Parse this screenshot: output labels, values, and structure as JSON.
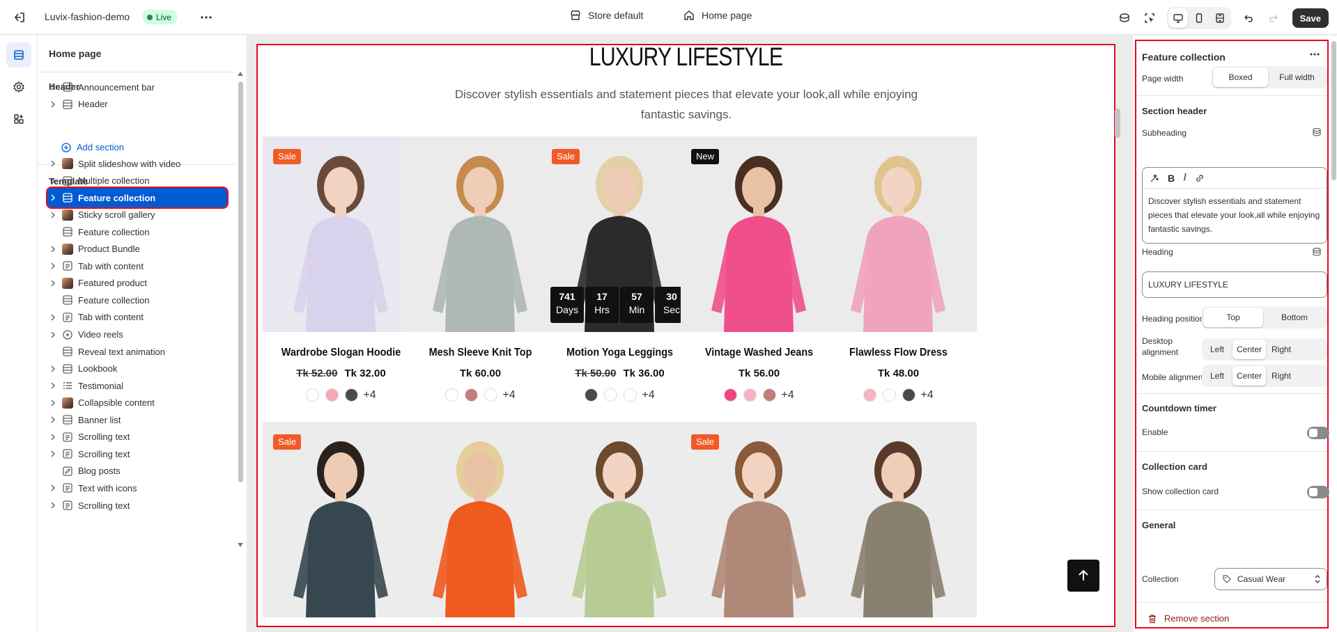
{
  "topbar": {
    "store_name": "Luvix-fashion-demo",
    "status": "Live",
    "theme": "Store default",
    "page": "Home page",
    "save_label": "Save"
  },
  "sidebar": {
    "title": "Home page",
    "header_group": "Header",
    "header_items": [
      {
        "label": "Announcement bar",
        "icon": "section-icon"
      },
      {
        "label": "Header",
        "icon": "section-icon"
      }
    ],
    "add_section": "Add section",
    "template_group": "Template",
    "template_items": [
      {
        "label": "Split slideshow with video",
        "icon": "thumbnail-icon"
      },
      {
        "label": "Multiple collection",
        "icon": "section-icon"
      },
      {
        "label": "Feature collection",
        "icon": "section-icon"
      },
      {
        "label": "Sticky scroll gallery",
        "icon": "thumbnail-icon"
      },
      {
        "label": "Feature collection",
        "icon": "section-icon"
      },
      {
        "label": "Product Bundle",
        "icon": "thumbnail-icon"
      },
      {
        "label": "Tab with content",
        "icon": "text-icon"
      },
      {
        "label": "Featured product",
        "icon": "thumbnail-icon"
      },
      {
        "label": "Feature collection",
        "icon": "section-icon"
      },
      {
        "label": "Tab with content",
        "icon": "text-icon"
      },
      {
        "label": "Video reels",
        "icon": "play-icon"
      },
      {
        "label": "Reveal text animation",
        "icon": "section-icon"
      },
      {
        "label": "Lookbook",
        "icon": "section-icon"
      },
      {
        "label": "Testimonial",
        "icon": "list-icon"
      },
      {
        "label": "Collapsible content",
        "icon": "thumbnail-icon"
      },
      {
        "label": "Banner list",
        "icon": "section-icon"
      },
      {
        "label": "Scrolling text",
        "icon": "text-icon"
      },
      {
        "label": "Scrolling text",
        "icon": "text-icon"
      },
      {
        "label": "Blog posts",
        "icon": "edit-icon"
      },
      {
        "label": "Text with icons",
        "icon": "text-icon"
      },
      {
        "label": "Scrolling text",
        "icon": "text-icon"
      }
    ],
    "selected_index": 2
  },
  "preview": {
    "heading": "LUXURY LIFESTYLE",
    "subheading": "Discover stylish essentials and statement pieces that elevate your look,all while enjoying fantastic savings.",
    "countdown": [
      {
        "value": "741",
        "unit": "Days"
      },
      {
        "value": "17",
        "unit": "Hrs"
      },
      {
        "value": "57",
        "unit": "Min"
      },
      {
        "value": "30",
        "unit": "Sec"
      }
    ],
    "products": [
      {
        "title": "Wardrobe Slogan Hoodie",
        "old_price": "Tk 52.00",
        "price": "Tk 32.00",
        "badge": "Sale",
        "swatches": [
          "#ffffff",
          "#f7a8b8",
          "#4a4a4a"
        ],
        "more": "+4",
        "bg": "#e9e7f0",
        "outfit": "#d9d2ec"
      },
      {
        "title": "Mesh Sleeve Knit Top",
        "old_price": "",
        "price": "Tk 60.00",
        "badge": "",
        "swatches": [
          "#ffffff",
          "#c27c7c",
          "#ffffff"
        ],
        "more": "+4",
        "bg": "#eceaea",
        "outfit": "#aeb8b2"
      },
      {
        "title": "Motion Yoga Leggings",
        "old_price": "Tk 50.00",
        "price": "Tk 36.00",
        "badge": "Sale",
        "swatches": [
          "#4a4a4a",
          "#ffffff",
          "#ffffff"
        ],
        "more": "+4",
        "bg": "#ebebeb",
        "outfit": "#2b2b2b"
      },
      {
        "title": "Vintage Washed Jeans",
        "old_price": "",
        "price": "Tk 56.00",
        "badge": "New",
        "swatches": [
          "#f0457f",
          "#f7b3c2",
          "#c27c7c"
        ],
        "more": "+4",
        "bg": "#ebebeb",
        "outfit": "#ef4f8b"
      },
      {
        "title": "Flawless Flow Dress",
        "old_price": "",
        "price": "Tk 48.00",
        "badge": "",
        "swatches": [
          "#f7b3c2",
          "#ffffff",
          "#4a4a4a"
        ],
        "more": "+4",
        "bg": "#ebebeb",
        "outfit": "#f0a3bd"
      }
    ],
    "row2": [
      {
        "badge": "Sale",
        "outfit": "#37474f"
      },
      {
        "badge": "",
        "outfit": "#ef5a1f"
      },
      {
        "badge": "",
        "outfit": "#b7cc95"
      },
      {
        "badge": "Sale",
        "outfit": "#b08878"
      },
      {
        "badge": "",
        "outfit": "#8a8070"
      }
    ]
  },
  "settings": {
    "title": "Feature collection",
    "page_width_label": "Page width",
    "page_width_options": [
      "Boxed",
      "Full width"
    ],
    "section_header": "Section header",
    "subheading_label": "Subheading",
    "subheading_value": "Discover stylish essentials and statement pieces that elevate your look,all while enjoying fantastic savings.",
    "heading_label": "Heading",
    "heading_value": "LUXURY LIFESTYLE",
    "heading_position_label": "Heading position",
    "heading_position_options": [
      "Top",
      "Bottom"
    ],
    "desktop_alignment_label": "Desktop alignment",
    "mobile_alignment_label": "Mobile alignment",
    "alignment_options": [
      "Left",
      "Center",
      "Right"
    ],
    "countdown_section": "Countdown timer",
    "enable_label": "Enable",
    "collection_card_section": "Collection card",
    "show_collection_card_label": "Show collection card",
    "general_section": "General",
    "collection_label": "Collection",
    "collection_value": "Casual Wear",
    "remove_label": "Remove section"
  }
}
